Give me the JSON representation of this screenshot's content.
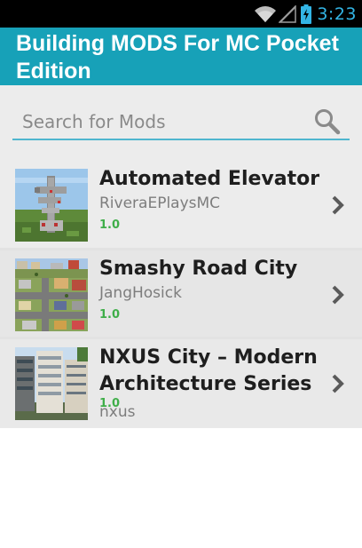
{
  "status_bar": {
    "time": "3:23",
    "icons": [
      "wifi-icon",
      "signal-icon",
      "battery-charging-icon"
    ],
    "accent_color": "#33b5e5"
  },
  "app_bar": {
    "title": "Building MODS For MC Pocket Edition",
    "color": "#17a1b8"
  },
  "search": {
    "placeholder": "Search for Mods",
    "value": "",
    "icon": "search-icon"
  },
  "mods": [
    {
      "title": "Automated Elevator",
      "author": "RiveraEPlaysMC",
      "version": "1.0"
    },
    {
      "title": "Smashy Road City",
      "author": "JangHosick",
      "version": "1.0"
    },
    {
      "title": "NXUS City – Modern Architecture Series",
      "author": "nxus",
      "version": "1.0"
    }
  ],
  "version_color": "#3fae49"
}
